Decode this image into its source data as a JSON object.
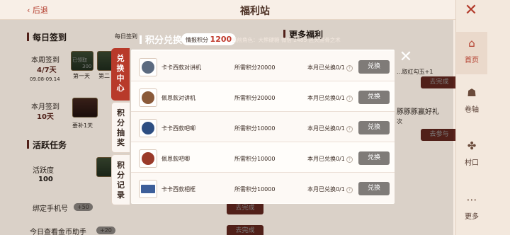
{
  "header": {
    "back_label": "后退",
    "title": "福利站"
  },
  "background": {
    "daily_signin": {
      "title": "每日签到",
      "week_label": "本周签到",
      "week_value": "4/7天",
      "week_range": "09.08-09.14",
      "month_label": "本月签到",
      "month_value": "10天",
      "day1": "第一天",
      "day2": "第二",
      "reward_value": "300",
      "claimed": "已领取",
      "resign": "要补1天"
    },
    "active_tasks": {
      "title": "活跃任务",
      "activity_label": "活跃度",
      "activity_value": "100",
      "bind_phone": "绑定手机号",
      "bind_phone_pts": "+50",
      "daily_view": "今日查看金币助手",
      "daily_view_pts": "+20",
      "go_complete": "去完成"
    },
    "more_benefits": {
      "title": "更多福利",
      "line1": "...取红勾玉+1",
      "line2": "豚豚豚赢好礼",
      "line3": "次",
      "btn_complete": "去完成",
      "btn_join": "去参与"
    },
    "hint_sign": "每日签到"
  },
  "sidebar": {
    "items": [
      {
        "label": "首页",
        "icon": "home-icon",
        "glyph": "⌂"
      },
      {
        "label": "卷轴",
        "icon": "scroll-icon",
        "glyph": "☗"
      },
      {
        "label": "村口",
        "icon": "pinwheel-icon",
        "glyph": "✤"
      },
      {
        "label": "更多",
        "icon": "more-icon",
        "glyph": "⋯"
      }
    ],
    "close_glyph": "✕"
  },
  "modal": {
    "title": "积分兑换",
    "points_label": "情报积分",
    "points_value": "1200",
    "role_text": "当前角色：大熊硬糖 微信 2485 区天涯骨之术",
    "close_glyph": "✕",
    "tabs": [
      {
        "label": "兑换中心",
        "active": true
      },
      {
        "label": "积分抽奖",
        "active": false
      },
      {
        "label": "积分记录",
        "active": false
      }
    ],
    "items": [
      {
        "name": "卡卡西款对讲机",
        "cost": "所需积分20000",
        "redeemed": "本月已兑换0/1",
        "button": "兑换",
        "thumb_color": "#5b6a80"
      },
      {
        "name": "佩恩款对讲机",
        "cost": "所需积分20000",
        "redeemed": "本月已兑换0/1",
        "button": "兑换",
        "thumb_color": "#8a5a3a"
      },
      {
        "name": "卡卡西款吧唧",
        "cost": "所需积分10000",
        "redeemed": "本月已兑换0/1",
        "button": "兑换",
        "thumb_color": "#2d4e82"
      },
      {
        "name": "佩恩款吧唧",
        "cost": "所需积分10000",
        "redeemed": "本月已兑换0/1",
        "button": "兑换",
        "thumb_color": "#9a3a2a"
      },
      {
        "name": "卡卡西款相框",
        "cost": "所需积分10000",
        "redeemed": "本月已兑换0/1",
        "button": "兑换",
        "thumb_color": "#3d5f9a"
      }
    ]
  },
  "colors": {
    "accent": "#b83a2a",
    "button_gray": "#7f7b78",
    "panel_bg": "#fffdfa"
  }
}
